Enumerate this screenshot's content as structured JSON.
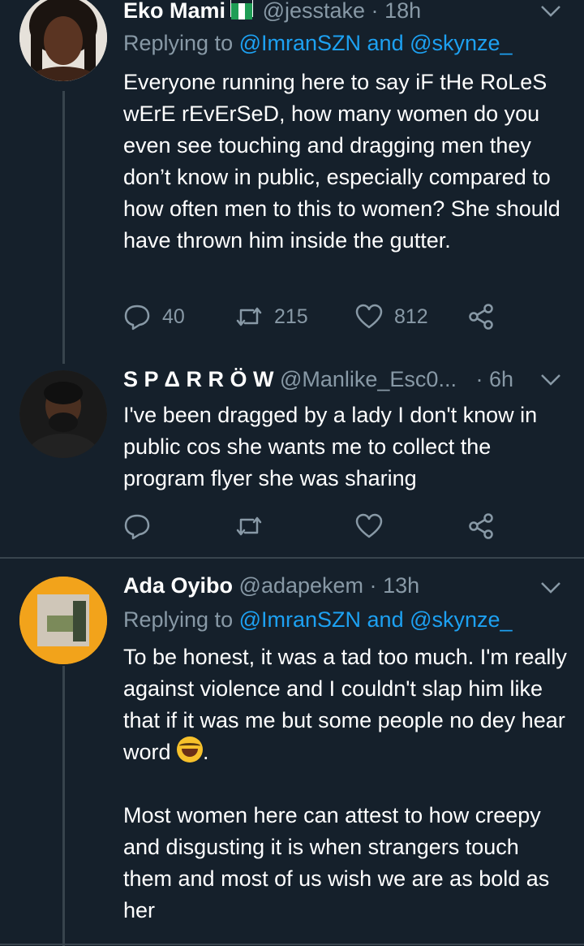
{
  "tweets": [
    {
      "name": "Eko Mami",
      "handle": "@jesstake",
      "separator": "·",
      "time": "18h",
      "replying_prefix": "Replying to",
      "replying_users": "@ImranSZN and @skynze_",
      "text": "Everyone running here to say iF tHe RoLeS wErE rEvErSeD, how many women do you even see touching and dragging men they don’t know in public, especially compared to how often men to this to women? She should have thrown him inside the gutter.",
      "replies": "40",
      "retweets": "215",
      "likes": "812"
    },
    {
      "name": "S P Δ R R Ö W",
      "handle": "@Manlike_Esc0...",
      "separator": "·",
      "time": "6h",
      "text": "I've been dragged by a lady I don't know in public cos she wants me to collect the program flyer she was sharing"
    },
    {
      "name": "Ada Oyibo",
      "handle": "@adapekem",
      "separator": "·",
      "time": "13h",
      "replying_prefix": "Replying to",
      "replying_users": "@ImranSZN and @skynze_",
      "text_p1": "To be honest, it was a tad too much. I'm really against violence and I couldn't slap him like that if it was me but some people no dey hear word",
      "text_p1_end": ".",
      "text_p2": "Most women here can attest to how creepy and disgusting it is when strangers touch them and most of us wish we are as bold as her"
    }
  ],
  "colors": {
    "background": "#15202b",
    "muted": "#8899a6",
    "link": "#1da1f2",
    "divider": "#38444d"
  },
  "icons": [
    "reply-icon",
    "retweet-icon",
    "like-icon",
    "share-icon",
    "chevron-down-icon",
    "nigeria-flag-icon",
    "tears-of-joy-emoji"
  ]
}
